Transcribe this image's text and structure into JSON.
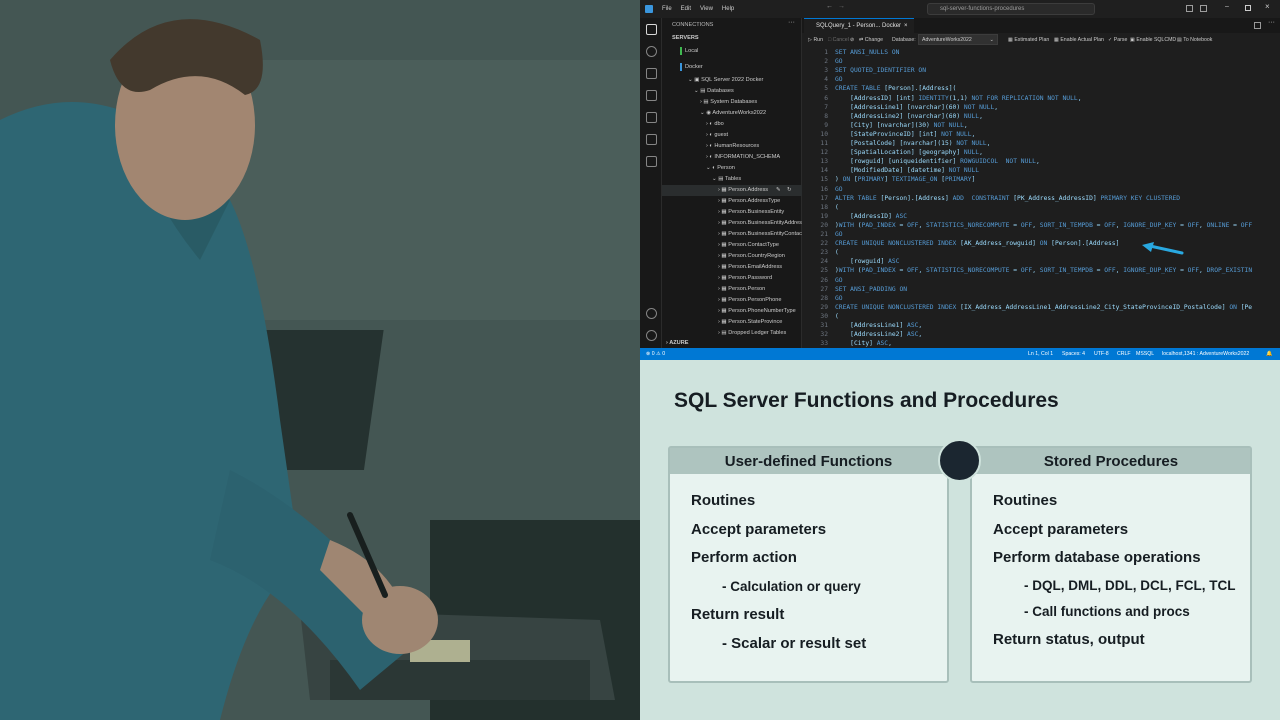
{
  "ide": {
    "menu": [
      "File",
      "Edit",
      "View",
      "Help"
    ],
    "command_center": "sql-server-functions-procedures",
    "sidebar": {
      "header": "CONNECTIONS",
      "servers_label": "SERVERS",
      "local": "Local",
      "docker": "Docker",
      "server": "SQL Server 2022 Docker",
      "databases": "Databases",
      "system_databases": "System Databases",
      "db": "AdventureWorks2022",
      "schemas": [
        "dbo",
        "guest",
        "HumanResources",
        "INFORMATION_SCHEMA",
        "Person"
      ],
      "tables_label": "Tables",
      "tables": [
        "Person.Address",
        "Person.AddressType",
        "Person.BusinessEntity",
        "Person.BusinessEntityAddress",
        "Person.BusinessEntityContact",
        "Person.ContactType",
        "Person.CountryRegion",
        "Person.EmailAddress",
        "Person.Password",
        "Person.Person",
        "Person.PersonPhone",
        "Person.PhoneNumberType",
        "Person.StateProvince"
      ],
      "dropped": "Dropped Ledger Tables",
      "azure": "AZURE"
    },
    "tab": "SQLQuery_1 - Person... Docker",
    "toolbar": {
      "run": "Run",
      "cancel": "Cancel",
      "change": "Change",
      "database_label": "Database:",
      "database_value": "AdventureWorks2022",
      "estimated": "Estimated Plan",
      "actual": "Enable Actual Plan",
      "parse": "Parse",
      "sqlcmd": "Enable SQLCMD",
      "notebook": "To Notebook"
    },
    "code_lines": [
      "SET ANSI_NULLS ON",
      "GO",
      "SET QUOTED_IDENTIFIER ON",
      "GO",
      "CREATE TABLE [Person].[Address](",
      "    [AddressID] [int] IDENTITY(1,1) NOT FOR REPLICATION NOT NULL,",
      "    [AddressLine1] [nvarchar](60) NOT NULL,",
      "    [AddressLine2] [nvarchar](60) NULL,",
      "    [City] [nvarchar](30) NOT NULL,",
      "    [StateProvinceID] [int] NOT NULL,",
      "    [PostalCode] [nvarchar](15) NOT NULL,",
      "    [SpatialLocation] [geography] NULL,",
      "    [rowguid] [uniqueidentifier] ROWGUIDCOL  NOT NULL,",
      "    [ModifiedDate] [datetime] NOT NULL",
      ") ON [PRIMARY] TEXTIMAGE_ON [PRIMARY]",
      "GO",
      "ALTER TABLE [Person].[Address] ADD  CONSTRAINT [PK_Address_AddressID] PRIMARY KEY CLUSTERED",
      "(",
      "    [AddressID] ASC",
      ")WITH (PAD_INDEX = OFF, STATISTICS_NORECOMPUTE = OFF, SORT_IN_TEMPDB = OFF, IGNORE_DUP_KEY = OFF, ONLINE = OFF",
      "GO",
      "CREATE UNIQUE NONCLUSTERED INDEX [AK_Address_rowguid] ON [Person].[Address]",
      "(",
      "    [rowguid] ASC",
      ")WITH (PAD_INDEX = OFF, STATISTICS_NORECOMPUTE = OFF, SORT_IN_TEMPDB = OFF, IGNORE_DUP_KEY = OFF, DROP_EXISTIN",
      "GO",
      "SET ANSI_PADDING ON",
      "GO",
      "CREATE UNIQUE NONCLUSTERED INDEX [IX_Address_AddressLine1_AddressLine2_City_StateProvinceID_PostalCode] ON [Pe",
      "(",
      "    [AddressLine1] ASC,",
      "    [AddressLine2] ASC,",
      "    [City] ASC,"
    ],
    "line_numbers": [
      "1",
      "2",
      "3",
      "4",
      "5",
      "6",
      "7",
      "8",
      "9",
      "10",
      "11",
      "12",
      "13",
      "14",
      "15",
      "16",
      "17",
      "18",
      "19",
      "20",
      "21",
      "22",
      "23",
      "24",
      "25",
      "26",
      "27",
      "28",
      "29",
      "30",
      "31",
      "32",
      "33"
    ],
    "status": {
      "left": "⊗ 0 ⚠ 0",
      "position": "Ln 1, Col 1",
      "spaces": "Spaces: 4",
      "encoding": "UTF-8",
      "eol": "CRLF",
      "lang": "MSSQL",
      "conn": "localhost,1341 : AdventureWorks2022"
    }
  },
  "slide": {
    "title": "SQL Server Functions and Procedures",
    "left_card": {
      "heading": "User-defined Functions",
      "items": [
        "Routines",
        "Accept parameters",
        "Perform action",
        "- Calculation or query",
        "Return result",
        "- Scalar or result set"
      ]
    },
    "right_card": {
      "heading": "Stored Procedures",
      "items": [
        "Routines",
        "Accept parameters",
        "Perform database operations",
        "- DQL, DML, DDL, DCL, FCL, TCL",
        "- Call functions and procs",
        "Return status, output"
      ]
    },
    "colors": {
      "background": "#cfe3dd",
      "card": "#e8f3f0",
      "header": "#aec4bf",
      "text": "#161d22"
    }
  }
}
